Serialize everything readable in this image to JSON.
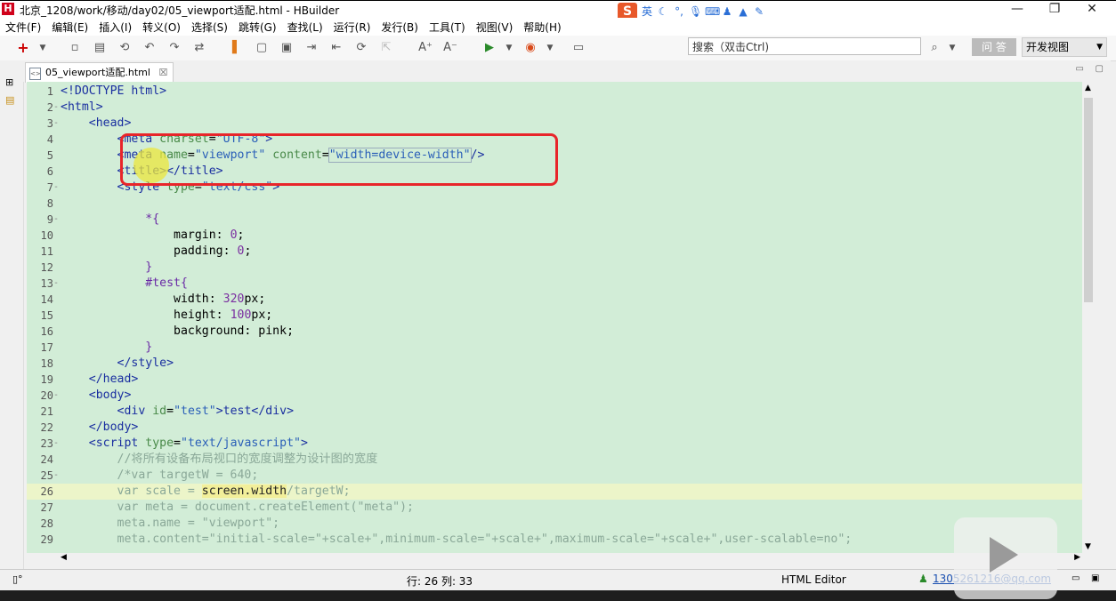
{
  "window": {
    "title": "北京_1208/work/移动/day02/05_viewport适配.html  - HBuilder",
    "logo": "H",
    "minimize": "—",
    "restore": "❐",
    "close": "✕"
  },
  "ime": {
    "logo": "S",
    "lang": "英"
  },
  "menu": [
    "文件(F)",
    "编辑(E)",
    "插入(I)",
    "转义(O)",
    "选择(S)",
    "跳转(G)",
    "查找(L)",
    "运行(R)",
    "发行(B)",
    "工具(T)",
    "视图(V)",
    "帮助(H)"
  ],
  "toolbar": {
    "search_placeholder": "搜索（双击Ctrl)",
    "ask_label": "问 答",
    "view_label": "开发视图"
  },
  "tab": {
    "label": "05_viewport适配.html",
    "close": "☒"
  },
  "lines": [
    {
      "n": "1",
      "f": ""
    },
    {
      "n": "2",
      "f": "-"
    },
    {
      "n": "3",
      "f": "-"
    },
    {
      "n": "4",
      "f": ""
    },
    {
      "n": "5",
      "f": ""
    },
    {
      "n": "6",
      "f": ""
    },
    {
      "n": "7",
      "f": "-"
    },
    {
      "n": "8",
      "f": ""
    },
    {
      "n": "9",
      "f": "-"
    },
    {
      "n": "10",
      "f": ""
    },
    {
      "n": "11",
      "f": ""
    },
    {
      "n": "12",
      "f": ""
    },
    {
      "n": "13",
      "f": "-"
    },
    {
      "n": "14",
      "f": ""
    },
    {
      "n": "15",
      "f": ""
    },
    {
      "n": "16",
      "f": ""
    },
    {
      "n": "17",
      "f": ""
    },
    {
      "n": "18",
      "f": ""
    },
    {
      "n": "19",
      "f": ""
    },
    {
      "n": "20",
      "f": "-"
    },
    {
      "n": "21",
      "f": ""
    },
    {
      "n": "22",
      "f": ""
    },
    {
      "n": "23",
      "f": "-"
    },
    {
      "n": "24",
      "f": ""
    },
    {
      "n": "25",
      "f": "-"
    },
    {
      "n": "26",
      "f": ""
    },
    {
      "n": "27",
      "f": ""
    },
    {
      "n": "28",
      "f": ""
    },
    {
      "n": "29",
      "f": ""
    }
  ],
  "code": {
    "l1": "<!DOCTYPE html>",
    "l2": "<html>",
    "l3": "    <head>",
    "l4a": "        <meta ",
    "l4b": "charset",
    "l4c": "=",
    "l4d": "\"UTF-8\"",
    "l4e": ">",
    "l5a": "        <meta ",
    "l5b": "name",
    "l5c": "=",
    "l5d": "\"viewport\"",
    "l5e": " content",
    "l5f": "=",
    "l5g": "\"width=device-width\"",
    "l5h": "/>",
    "l6": "        <title></title>",
    "l7a": "        <style ",
    "l7b": "type",
    "l7c": "=",
    "l7d": "\"text/css\"",
    "l7e": ">",
    "l8": "",
    "l9": "            *{",
    "l10a": "                margin: ",
    "l10b": "0",
    "l10c": ";",
    "l11a": "                padding: ",
    "l11b": "0",
    "l11c": ";",
    "l12": "            }",
    "l13": "            #test{",
    "l14a": "                width: ",
    "l14b": "320",
    "l14c": "px;",
    "l15a": "                height: ",
    "l15b": "100",
    "l15c": "px;",
    "l16": "                background: pink;",
    "l17": "            }",
    "l18": "        </style>",
    "l19": "    </head>",
    "l20": "    <body>",
    "l21a": "        <div ",
    "l21b": "id",
    "l21c": "=",
    "l21d": "\"test\"",
    "l21e": ">test</div>",
    "l22": "    </body>",
    "l23a": "    <script ",
    "l23b": "type",
    "l23c": "=",
    "l23d": "\"text/javascript\"",
    "l23e": ">",
    "l24": "        //将所有设备布局视口的宽度调整为设计图的宽度",
    "l25": "        /*var targetW = 640;",
    "l26a": "        var scale = ",
    "l26b": "screen.width",
    "l26c": "/targetW;",
    "l27": "        var meta = document.createElement(\"meta\");",
    "l28": "        meta.name = \"viewport\";",
    "l29": "        meta.content=\"initial-scale=\"+scale+\",minimum-scale=\"+scale+\",maximum-scale=\"+scale+\",user-scalable=no\";"
  },
  "status": {
    "position": "行: 26 列: 33",
    "mode": "HTML Editor",
    "user": "1305261216@qq.com"
  },
  "colors": {
    "editor_bg": "#d2edd7",
    "annotation": "#e8252a",
    "current_line": "#ecf5c9"
  },
  "icons": [
    "new-icon",
    "save-icon",
    "undo-icon",
    "redo-icon",
    "bookmark-icon",
    "run-icon",
    "browser-icon",
    "search-icon",
    "user-icon"
  ]
}
